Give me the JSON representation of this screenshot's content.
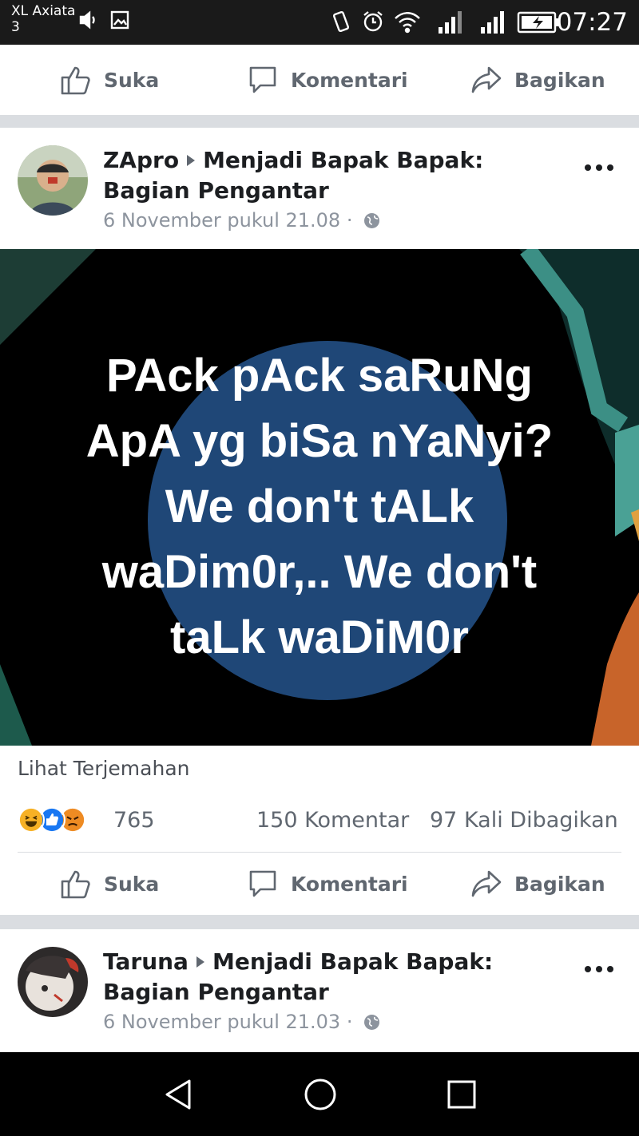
{
  "status_bar": {
    "carrier_line1": "XL Axiata",
    "carrier_line2": "3",
    "time": "07:27",
    "icons": [
      "volume-icon",
      "image-notification-icon",
      "vibrate-icon",
      "alarm-icon",
      "wifi-icon",
      "signal-icon",
      "signal-icon",
      "battery-charging-icon"
    ]
  },
  "actions": {
    "like": "Suka",
    "comment": "Komentari",
    "share": "Bagikan"
  },
  "post1": {
    "author": "ZApro",
    "group": "Menjadi Bapak Bapak: Bagian Pengantar",
    "time": "6 November pukul 21.08 ·",
    "image_text_lines": [
      "PAck pAck saRuNg",
      "ApA yg biSa nYaNyi?",
      "We don't tALk",
      "waDim0r,.. We don't",
      "taLk waDiM0r"
    ],
    "translate_link": "Lihat Terjemahan",
    "reaction_count": "765",
    "comments": "150 Komentar",
    "shares": "97 Kali Dibagikan",
    "reaction_icons": [
      "haha-icon",
      "like-icon",
      "angry-icon"
    ]
  },
  "post2": {
    "author": "Taruna",
    "group": "Menjadi Bapak Bapak: Bagian Pengantar",
    "time": "6 November pukul 21.03 ·"
  },
  "colors": {
    "text_primary": "#1c1e21",
    "text_secondary": "#606770",
    "facebook_blue": "#1877f2",
    "divider": "#dadde1"
  },
  "nav_icons": [
    "back-icon",
    "home-icon",
    "recents-icon"
  ]
}
